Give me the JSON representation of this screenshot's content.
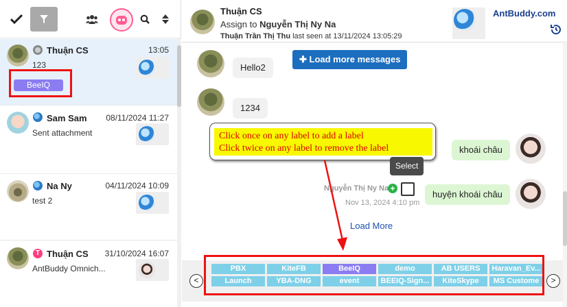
{
  "toolbar": {
    "check_icon": "check-icon",
    "filter_icon": "filter-icon",
    "users_icon": "users-icon",
    "bot_icon": "bot-icon",
    "search_icon": "search-icon",
    "sort_icon": "sort-icon"
  },
  "conversations": [
    {
      "name": "Thuận CS",
      "time": "13:05",
      "message": "123",
      "label": "BeeIQ"
    },
    {
      "name": "Sam Sam",
      "time": "08/11/2024 11:27",
      "message": "Sent attachment"
    },
    {
      "name": "Na Ny",
      "time": "04/11/2024 10:09",
      "message": "test 2"
    },
    {
      "name": "Thuận CS",
      "time": "31/10/2024 16:07",
      "message": "AntBuddy Omnich..."
    }
  ],
  "header": {
    "name": "Thuận CS",
    "assign_prefix": "Assign to ",
    "assignee": "Nguyễn Thị Ny Na",
    "seen_name": "Thuận Trần Thị Thu",
    "seen_text": " last seen at 13/11/2024 13:05:29",
    "brand": "AntBuddy.com"
  },
  "chat": {
    "load_more_button": "Load more messages",
    "messages_in": [
      "Hello2",
      "1234"
    ],
    "messages_out": [
      "khoái châu",
      "huyện khoái châu"
    ],
    "tooltip_line1": "Click once on any label to add a label",
    "tooltip_line2": "Click twice on any label to remove the label",
    "select_tip": "Select",
    "meta_name": "Nguyễn Thị Ny Na",
    "meta_time": "Nov 13, 2024 4:10 pm",
    "load_more_link": "Load More"
  },
  "labels": [
    "PBX",
    "KiteFB",
    "BeeIQ",
    "demo",
    "AB USERS",
    "Haravan_Ev...",
    "Launch",
    "YBA-DNG",
    "event",
    "BEEIQ-Sign...",
    "KiteSkype",
    "MS Custome"
  ],
  "selected_label": "BeeIQ",
  "colors": {
    "label_chip": "#7ed0e8",
    "label_selected": "#8b7cf2",
    "primary": "#1c6ebf",
    "highlight": "#e11111"
  }
}
